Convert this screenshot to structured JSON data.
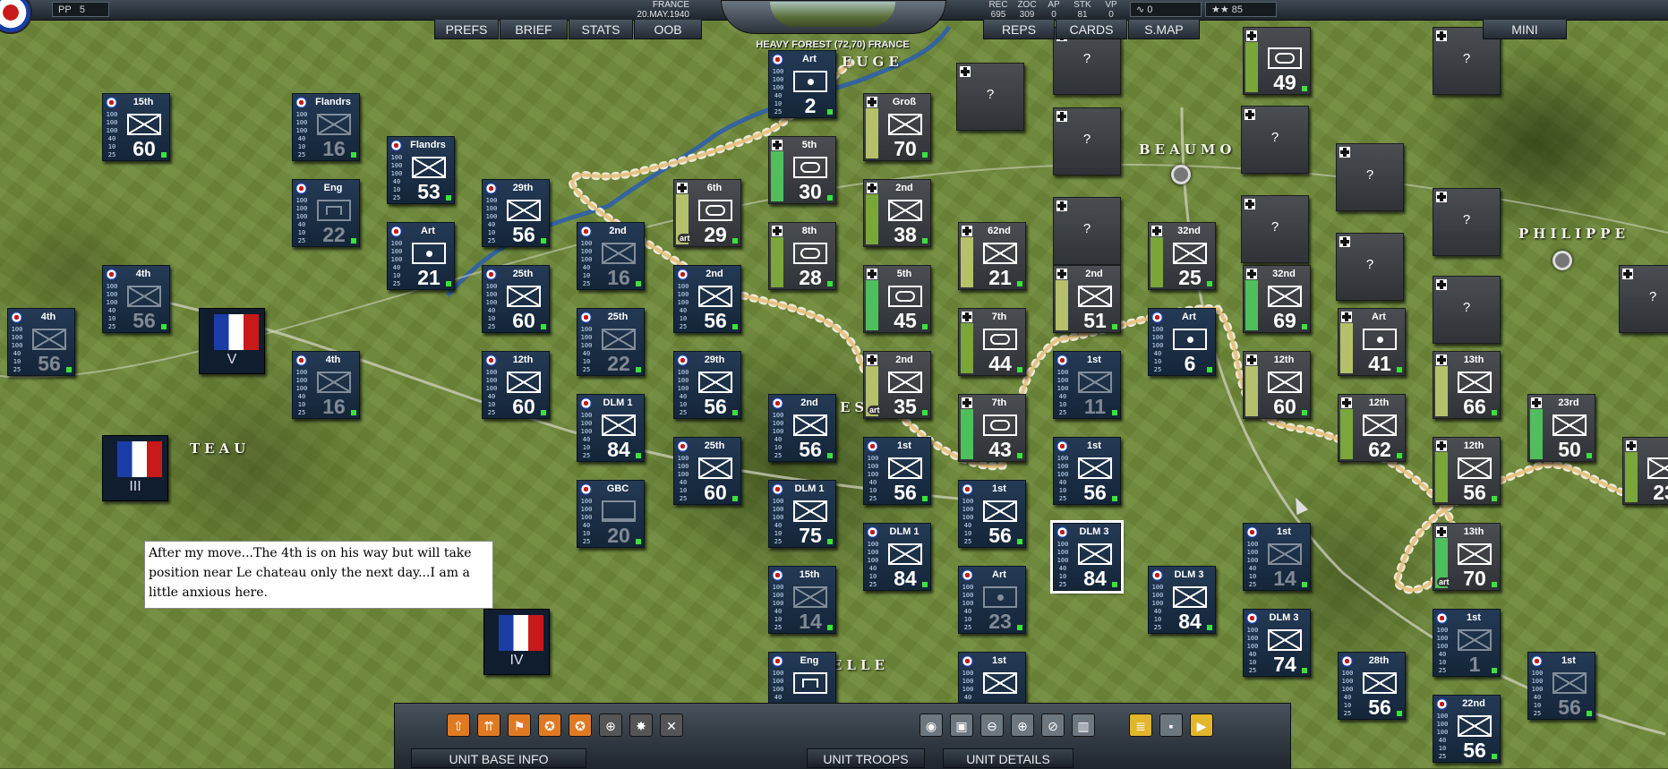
{
  "topbar": {
    "pp_label": "PP",
    "pp_value": "5",
    "country": "FRANCE",
    "date": "20.MAY.1940",
    "stats": [
      {
        "label": "REC",
        "value": "695"
      },
      {
        "label": "ZOC",
        "value": "309"
      },
      {
        "label": "AP",
        "value": "0"
      },
      {
        "label": "STK",
        "value": "81"
      },
      {
        "label": "VP",
        "value": "0"
      }
    ],
    "trend_value": "0",
    "stars_value": "85",
    "terrain_info": "HEAVY FOREST (72,70) FRANCE"
  },
  "nav_tabs": [
    "PREFS",
    "BRIEF",
    "STATS",
    "OOB",
    "REPS",
    "CARDS",
    "S.MAP",
    "MINI"
  ],
  "towns": [
    "BEAUMO",
    "PHILIPPE",
    "LE CHATEAU",
    "MAUBEUGE",
    "AVESNES",
    "LA CAPELLE"
  ],
  "town_fragments": [
    "M",
    "EUGE",
    "BEAUMO",
    "PHILIPPE",
    "L",
    "TEAU",
    "A",
    "ES",
    "L",
    "APELLE",
    "C",
    "Y"
  ],
  "note_text": "After my move...The 4th is on his way but will take position near Le chateau only the next day...I am a little anxious here.",
  "bottom_tabs": [
    "UNIT BASE INFO",
    "UNIT TROOPS",
    "UNIT DETAILS"
  ],
  "toolbar_icons": [
    "move-up-icon",
    "move-all-icon",
    "flag-icon",
    "upgrade-icon",
    "upgrade-all-icon",
    "target-icon",
    "explosion-icon",
    "disband-icon",
    "camera-icon",
    "view-icon",
    "zoom-out-icon",
    "zoom-in-icon",
    "zoom-reset-icon",
    "trash-icon",
    "report-icon",
    "save-icon",
    "end-turn-icon"
  ],
  "hq_units": [
    {
      "id": "hq-v",
      "roman": "V"
    },
    {
      "id": "hq-iii",
      "roman": "III"
    },
    {
      "id": "hq-iv",
      "roman": "IV"
    }
  ],
  "units": [
    {
      "side": "fr",
      "name": "15th",
      "type": "inf",
      "str": "60"
    },
    {
      "side": "fr",
      "name": "Flandrs",
      "type": "inf",
      "str": "16",
      "dim": true
    },
    {
      "side": "fr",
      "name": "Flandrs",
      "type": "inf",
      "str": "53"
    },
    {
      "side": "fr",
      "name": "Eng",
      "type": "eng",
      "str": "22",
      "dim": true
    },
    {
      "side": "fr",
      "name": "Art",
      "type": "art",
      "str": "21"
    },
    {
      "side": "fr",
      "name": "29th",
      "type": "inf",
      "str": "56"
    },
    {
      "side": "fr",
      "name": "2nd",
      "type": "inf",
      "str": "16",
      "dim": true
    },
    {
      "side": "fr",
      "name": "4th",
      "type": "inf",
      "str": "56",
      "dim": true
    },
    {
      "side": "fr",
      "name": "4th",
      "type": "inf",
      "str": "56",
      "dim": true
    },
    {
      "side": "fr",
      "name": "25th",
      "type": "inf",
      "str": "60"
    },
    {
      "side": "fr",
      "name": "25th",
      "type": "inf",
      "str": "22",
      "dim": true
    },
    {
      "side": "fr",
      "name": "4th",
      "type": "inf",
      "str": "16",
      "dim": true
    },
    {
      "side": "fr",
      "name": "12th",
      "type": "inf",
      "str": "60"
    },
    {
      "side": "fr",
      "name": "DLM 1",
      "type": "inf",
      "str": "84"
    },
    {
      "side": "fr",
      "name": "GBC",
      "type": "hq",
      "str": "20",
      "dim": true
    },
    {
      "side": "fr",
      "name": "Art",
      "type": "art",
      "str": "2"
    },
    {
      "side": "de",
      "name": "5th",
      "type": "arm",
      "str": "30"
    },
    {
      "side": "de",
      "name": "6th",
      "type": "arm",
      "str": "29",
      "tag": "art"
    },
    {
      "side": "de",
      "name": "8th",
      "type": "arm",
      "str": "28"
    },
    {
      "side": "fr",
      "name": "2nd",
      "type": "inf",
      "str": "56"
    },
    {
      "side": "fr",
      "name": "29th",
      "type": "inf",
      "str": "56"
    },
    {
      "side": "fr",
      "name": "25th",
      "type": "inf",
      "str": "60"
    },
    {
      "side": "fr",
      "name": "2nd",
      "type": "inf",
      "str": "56"
    },
    {
      "side": "fr",
      "name": "DLM 1",
      "type": "inf",
      "str": "75"
    },
    {
      "side": "fr",
      "name": "15th",
      "type": "inf",
      "str": "14",
      "dim": true
    },
    {
      "side": "fr",
      "name": "Eng",
      "type": "eng",
      "str": ""
    },
    {
      "side": "de",
      "name": "Groß",
      "type": "inf",
      "str": "70"
    },
    {
      "side": "de",
      "name": "2nd",
      "type": "inf",
      "str": "38"
    },
    {
      "side": "de",
      "name": "5th",
      "type": "arm",
      "str": "45"
    },
    {
      "side": "de",
      "name": "2nd",
      "type": "inf",
      "str": "35",
      "tag": "art"
    },
    {
      "side": "fr",
      "name": "1st",
      "type": "inf",
      "str": "56"
    },
    {
      "side": "fr",
      "name": "DLM 1",
      "type": "inf",
      "str": "84"
    },
    {
      "side": "de",
      "name": "62nd",
      "type": "inf",
      "str": "21"
    },
    {
      "side": "de",
      "name": "7th",
      "type": "arm",
      "str": "44"
    },
    {
      "side": "de",
      "name": "7th",
      "type": "arm",
      "str": "43"
    },
    {
      "side": "fr",
      "name": "1st",
      "type": "inf",
      "str": "56"
    },
    {
      "side": "fr",
      "name": "Art",
      "type": "art",
      "str": "23",
      "dim": true
    },
    {
      "side": "fr",
      "name": "1st",
      "type": "inf",
      "str": ""
    },
    {
      "side": "de",
      "name": "2nd",
      "type": "inf",
      "str": "51"
    },
    {
      "side": "fr",
      "name": "1st",
      "type": "inf",
      "str": "11",
      "dim": true
    },
    {
      "side": "fr",
      "name": "1st",
      "type": "inf",
      "str": "56"
    },
    {
      "side": "fr",
      "name": "DLM 3",
      "type": "inf",
      "str": "84",
      "selected": true
    },
    {
      "side": "de",
      "name": "32nd",
      "type": "inf",
      "str": "25"
    },
    {
      "side": "fr",
      "name": "Art",
      "type": "art",
      "str": "6"
    },
    {
      "side": "fr",
      "name": "DLM 3",
      "type": "inf",
      "str": "84"
    },
    {
      "side": "de",
      "name": "",
      "type": "arm",
      "str": "49"
    },
    {
      "side": "de",
      "name": "32nd",
      "type": "inf",
      "str": "69"
    },
    {
      "side": "de",
      "name": "12th",
      "type": "inf",
      "str": "60"
    },
    {
      "side": "fr",
      "name": "1st",
      "type": "inf",
      "str": "14",
      "dim": true
    },
    {
      "side": "fr",
      "name": "DLM 3",
      "type": "inf",
      "str": "74"
    },
    {
      "side": "de",
      "name": "Art",
      "type": "art",
      "str": "41"
    },
    {
      "side": "de",
      "name": "12th",
      "type": "inf",
      "str": "62"
    },
    {
      "side": "fr",
      "name": "28th",
      "type": "inf",
      "str": "56"
    },
    {
      "side": "de",
      "name": "13th",
      "type": "inf",
      "str": "66"
    },
    {
      "side": "de",
      "name": "12th",
      "type": "inf",
      "str": "56"
    },
    {
      "side": "de",
      "name": "13th",
      "type": "inf",
      "str": "70",
      "tag": "art"
    },
    {
      "side": "fr",
      "name": "1st",
      "type": "inf",
      "str": "1",
      "dim": true
    },
    {
      "side": "fr",
      "name": "22nd",
      "type": "inf",
      "str": "56"
    },
    {
      "side": "de",
      "name": "23rd",
      "type": "inf",
      "str": "50"
    },
    {
      "side": "fr",
      "name": "1st",
      "type": "inf",
      "str": "56",
      "dim": true
    },
    {
      "side": "de",
      "name": "",
      "type": "inf",
      "str": "23"
    }
  ],
  "unknown_mark": "?",
  "unit_stat_values": [
    "100",
    "100",
    "100",
    "40",
    "10",
    "25"
  ]
}
